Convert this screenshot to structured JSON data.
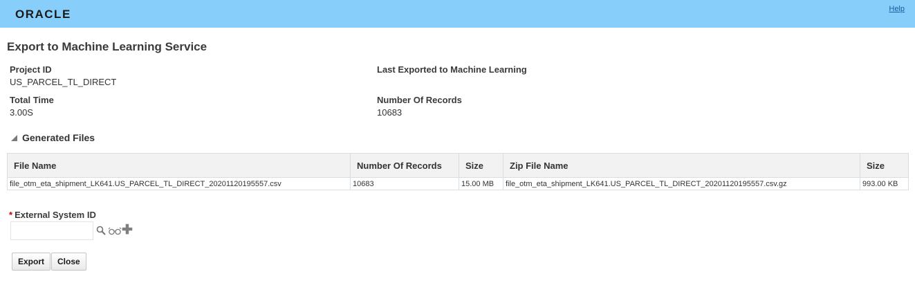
{
  "header": {
    "logo": "ORACLE",
    "help": "Help"
  },
  "page": {
    "title": "Export to Machine Learning Service"
  },
  "summary": {
    "project_id_label": "Project ID",
    "project_id_value": "US_PARCEL_TL_DIRECT",
    "last_exported_label": "Last Exported to Machine Learning",
    "total_time_label": "Total Time",
    "total_time_value": "3.00S",
    "records_label": "Number Of Records",
    "records_value": "10683"
  },
  "generated_files": {
    "title": "Generated Files",
    "columns": [
      "File Name",
      "Number Of Records",
      "Size",
      "Zip File Name",
      "Size"
    ],
    "rows": [
      [
        "file_otm_eta_shipment_LK641.US_PARCEL_TL_DIRECT_20201120195557.csv",
        "10683",
        "15.00 MB",
        "file_otm_eta_shipment_LK641.US_PARCEL_TL_DIRECT_20201120195557.csv.gz",
        "993.00 KB"
      ]
    ]
  },
  "external_system": {
    "required_marker": "*",
    "label": "External System ID",
    "value": ""
  },
  "icons": [
    "search-icon",
    "view-icon",
    "add-icon"
  ],
  "buttons": {
    "export": "Export",
    "close": "Close"
  }
}
